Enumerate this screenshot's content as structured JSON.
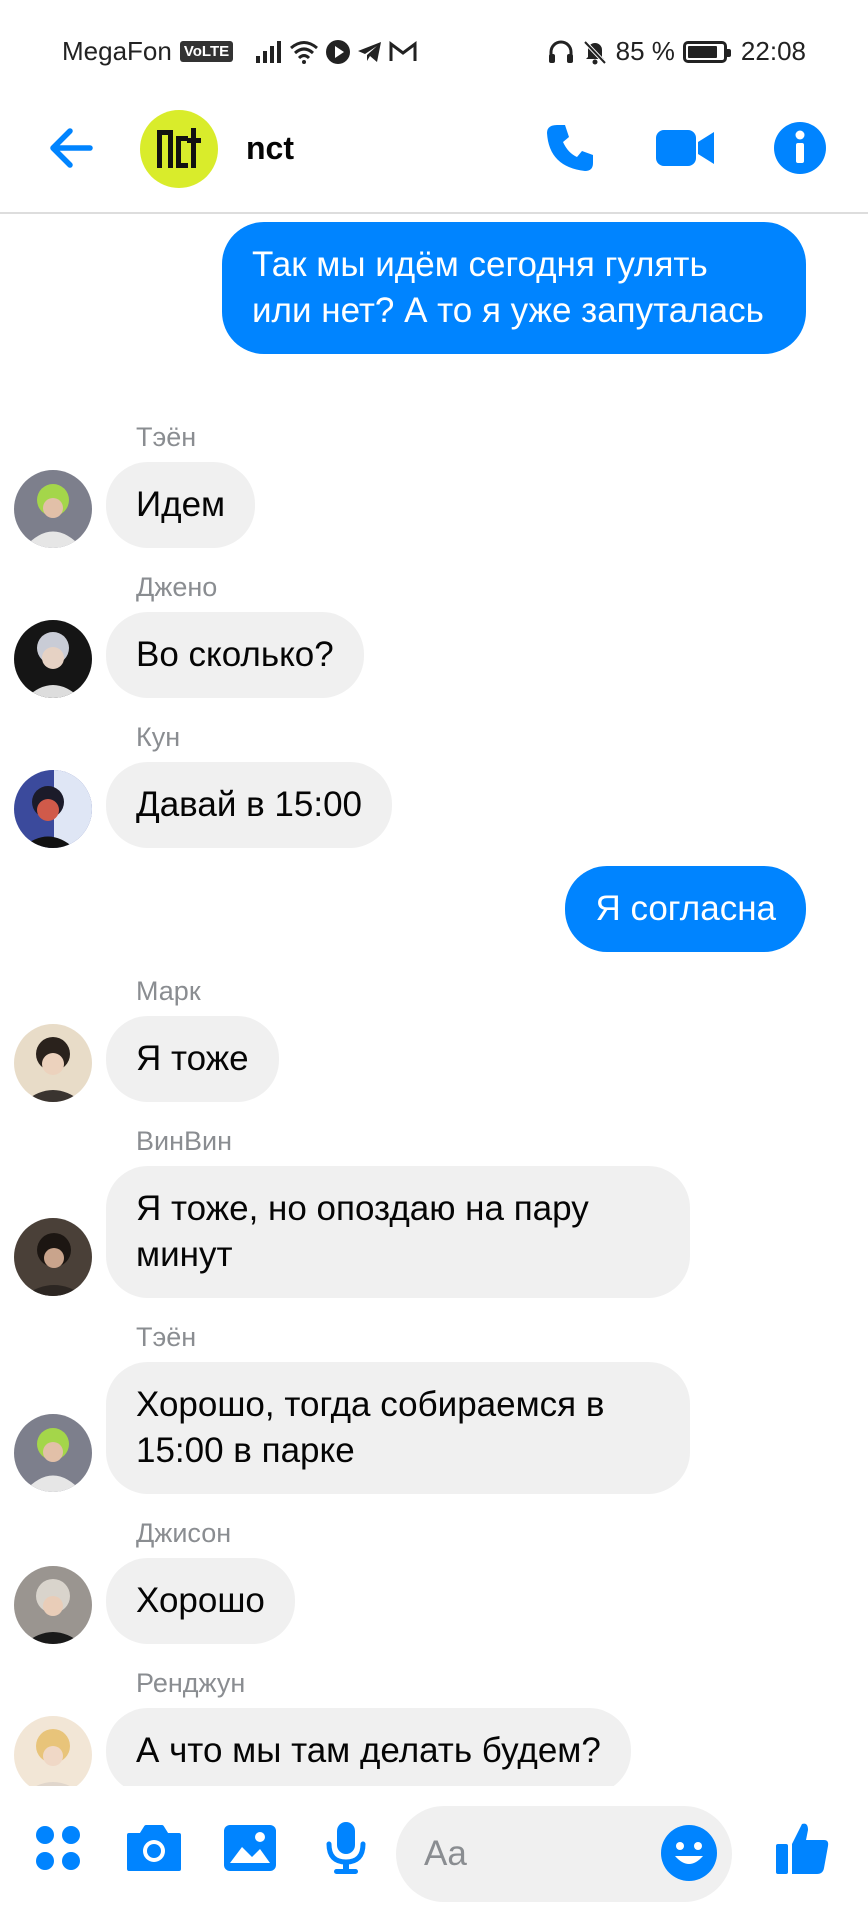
{
  "status_bar": {
    "carrier": "MegaFon",
    "network_badge": "VoLTE",
    "battery_percent_text": "85 %",
    "battery_level": 0.85,
    "time": "22:08",
    "icons": [
      "signal-icon",
      "wifi-icon",
      "play-icon",
      "telegram-icon",
      "gmail-icon",
      "headphones-icon",
      "bell-off-icon",
      "battery-icon"
    ]
  },
  "header": {
    "title": "nct",
    "avatar_text": "nct",
    "icons": [
      "back-arrow-icon",
      "phone-icon",
      "video-camera-icon",
      "info-icon"
    ],
    "accent_color": "#0084ff"
  },
  "messages": [
    {
      "side": "out",
      "text": "Так мы идём сегодня гулять или нет? А то я уже запуталась"
    },
    {
      "side": "in",
      "sender": "Тэён",
      "text": "Идем"
    },
    {
      "side": "in",
      "sender": "Джено",
      "text": "Во сколько?"
    },
    {
      "side": "in",
      "sender": "Кун",
      "text": "Давай в 15:00"
    },
    {
      "side": "out",
      "text": "Я согласна"
    },
    {
      "side": "in",
      "sender": "Марк",
      "text": "Я тоже"
    },
    {
      "side": "in",
      "sender": "ВинВин",
      "text": "Я тоже, но опоздаю на пару минут"
    },
    {
      "side": "in",
      "sender": "Тэён",
      "text": "Хорошо, тогда собираемся в 15:00 в парке"
    },
    {
      "side": "in",
      "sender": "Джисон",
      "text": "Хорошо"
    },
    {
      "side": "in",
      "sender": "Ренджун",
      "text": "А что мы там делать будем?"
    }
  ],
  "composer": {
    "placeholder": "Aa",
    "icons": [
      "menu-dots-icon",
      "camera-icon",
      "gallery-icon",
      "microphone-icon",
      "emoji-icon",
      "thumbs-up-icon"
    ]
  },
  "colors": {
    "outgoing_bubble": "#0084ff",
    "incoming_bubble": "#f0f0f0",
    "sender_name": "#8a8d91",
    "group_avatar": "#d9ec2b"
  }
}
